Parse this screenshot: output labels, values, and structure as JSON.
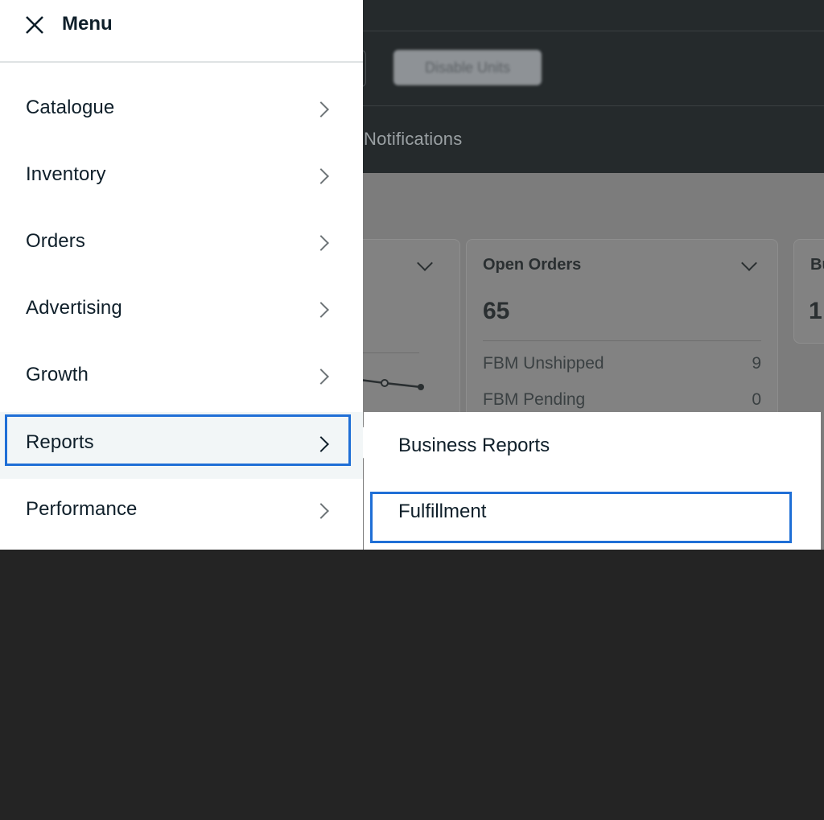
{
  "menu": {
    "title": "Menu",
    "items": [
      {
        "label": "Catalogue"
      },
      {
        "label": "Inventory"
      },
      {
        "label": "Orders"
      },
      {
        "label": "Advertising"
      },
      {
        "label": "Growth"
      },
      {
        "label": "Reports"
      },
      {
        "label": "Performance"
      }
    ],
    "active_item": "Reports"
  },
  "submenu": {
    "items": [
      {
        "label": "Business Reports"
      },
      {
        "label": "Fulfillment"
      }
    ],
    "focused_item": "Fulfillment"
  },
  "background": {
    "blurred_button": "Disable Units",
    "nav_tab": "Notifications",
    "open_orders_card": {
      "title": "Open Orders",
      "value": "65",
      "rows": [
        {
          "label": "FBM Unshipped",
          "value": "9"
        },
        {
          "label": "FBM Pending",
          "value": "0"
        }
      ]
    },
    "partial_card": {
      "title": "Bu",
      "value": "1"
    }
  },
  "colors": {
    "focus_ring": "#1f6fd6",
    "text": "#0f1f2a",
    "overlay_bg": "#242424"
  }
}
